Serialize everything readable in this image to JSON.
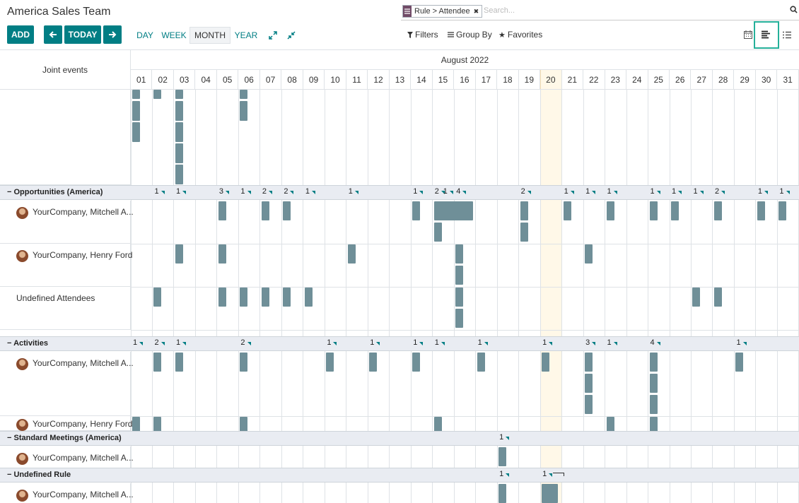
{
  "app": {
    "title": "America Sales Team"
  },
  "controls": {
    "add_label": "ADD",
    "today_label": "TODAY",
    "scales": [
      "DAY",
      "WEEK",
      "MONTH",
      "YEAR"
    ],
    "active_scale": "MONTH"
  },
  "search": {
    "facet_label": "Rule > Attendee",
    "placeholder": "Search..."
  },
  "filters": {
    "filters_label": "Filters",
    "groupby_label": "Group By",
    "favorites_label": "Favorites"
  },
  "view_switcher": {
    "views": [
      "calendar-view-icon",
      "gantt-view-icon",
      "list-view-icon"
    ],
    "active": "gantt-view-icon",
    "highlight_color": "#25b09a"
  },
  "gantt": {
    "joint_events_label": "Joint events",
    "month_title": "August 2022",
    "days": [
      "01",
      "02",
      "03",
      "04",
      "05",
      "06",
      "07",
      "08",
      "09",
      "10",
      "11",
      "12",
      "13",
      "14",
      "15",
      "16",
      "17",
      "18",
      "19",
      "20",
      "21",
      "22",
      "23",
      "24",
      "25",
      "26",
      "27",
      "28",
      "29",
      "30",
      "31"
    ],
    "today_day": "20",
    "pill_color": "#6f8f98",
    "accent_color": "#017e84",
    "groups": [
      {
        "name": "Opportunities (America)",
        "counts": [
          {
            "day": 2,
            "n": "1"
          },
          {
            "day": 3,
            "n": "1"
          },
          {
            "day": 5,
            "n": "3"
          },
          {
            "day": 6,
            "n": "1"
          },
          {
            "day": 7,
            "n": "2"
          },
          {
            "day": 8,
            "n": "2"
          },
          {
            "day": 9,
            "n": "1"
          },
          {
            "day": 11,
            "n": "1"
          },
          {
            "day": 14,
            "n": "1"
          },
          {
            "day": 15,
            "n": "2"
          },
          {
            "day": 15.5,
            "n": "1"
          },
          {
            "day": 16,
            "n": "4"
          },
          {
            "day": 19,
            "n": "2"
          },
          {
            "day": 21,
            "n": "1"
          },
          {
            "day": 22,
            "n": "1"
          },
          {
            "day": 23,
            "n": "1"
          },
          {
            "day": 25,
            "n": "1"
          },
          {
            "day": 26,
            "n": "1"
          },
          {
            "day": 27,
            "n": "1"
          },
          {
            "day": 28,
            "n": "2"
          },
          {
            "day": 30,
            "n": "1"
          },
          {
            "day": 31,
            "n": "1"
          }
        ],
        "rows": [
          {
            "label": "YourCompany, Mitchell A...",
            "avatar": true
          },
          {
            "label": "YourCompany, Henry Ford",
            "avatar": true
          },
          {
            "label": "Undefined Attendees",
            "avatar": false
          }
        ]
      },
      {
        "name": "Activities",
        "counts": [
          {
            "day": 1,
            "n": "1"
          },
          {
            "day": 2,
            "n": "2"
          },
          {
            "day": 3,
            "n": "1"
          },
          {
            "day": 6,
            "n": "2"
          },
          {
            "day": 10,
            "n": "1"
          },
          {
            "day": 12,
            "n": "1"
          },
          {
            "day": 14,
            "n": "1"
          },
          {
            "day": 15,
            "n": "1"
          },
          {
            "day": 17,
            "n": "1"
          },
          {
            "day": 20,
            "n": "1"
          },
          {
            "day": 22,
            "n": "3"
          },
          {
            "day": 23,
            "n": "1"
          },
          {
            "day": 25,
            "n": "4"
          },
          {
            "day": 29,
            "n": "1"
          }
        ],
        "rows": [
          {
            "label": "YourCompany, Mitchell A...",
            "avatar": true
          },
          {
            "label": "YourCompany, Henry Ford",
            "avatar": true
          }
        ]
      },
      {
        "name": "Standard Meetings (America)",
        "counts": [
          {
            "day": 18,
            "n": "1"
          }
        ],
        "rows": [
          {
            "label": "YourCompany, Mitchell A...",
            "avatar": true
          }
        ]
      },
      {
        "name": "Undefined Rule",
        "counts": [
          {
            "day": 18,
            "n": "1"
          },
          {
            "day": 20,
            "n": "1"
          }
        ],
        "rows": [
          {
            "label": "YourCompany, Mitchell A...",
            "avatar": true
          }
        ]
      }
    ]
  }
}
